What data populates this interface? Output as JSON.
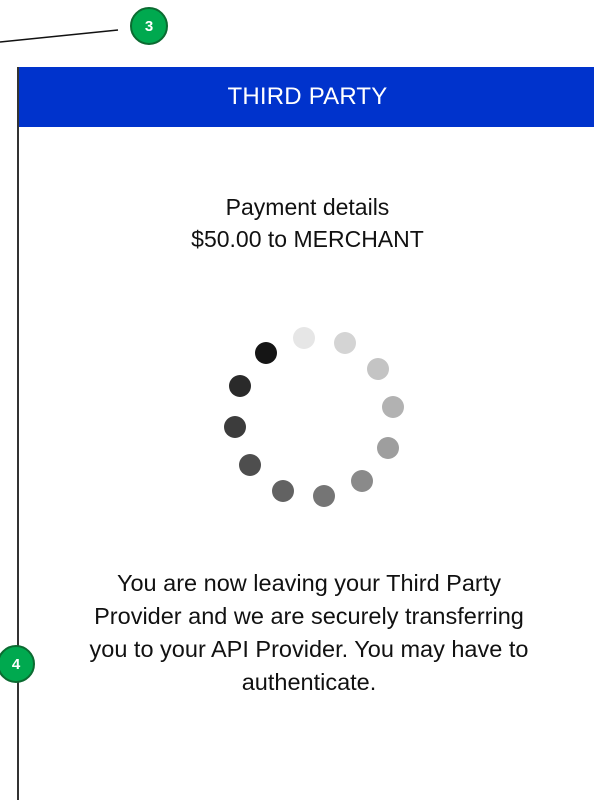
{
  "annotations": {
    "badge_3": "3",
    "badge_4": "4"
  },
  "header": {
    "title": "THIRD PARTY",
    "color": "#0033cc"
  },
  "payment": {
    "line1": "Payment details",
    "line2": "$50.00 to MERCHANT"
  },
  "spinner": {
    "icon": "loading-spinner-icon",
    "dot_colors": [
      "#e6e6e6",
      "#d4d4d4",
      "#c4c4c4",
      "#b2b2b2",
      "#9e9e9e",
      "#8a8a8a",
      "#757575",
      "#626262",
      "#4e4e4e",
      "#3c3c3c",
      "#2a2a2a",
      "#151515"
    ]
  },
  "message": {
    "text": "You are now leaving your Third Party Provider and we are securely transferring you to your API Provider. You may have to authenticate."
  },
  "colors": {
    "badge": "#00a94f"
  }
}
